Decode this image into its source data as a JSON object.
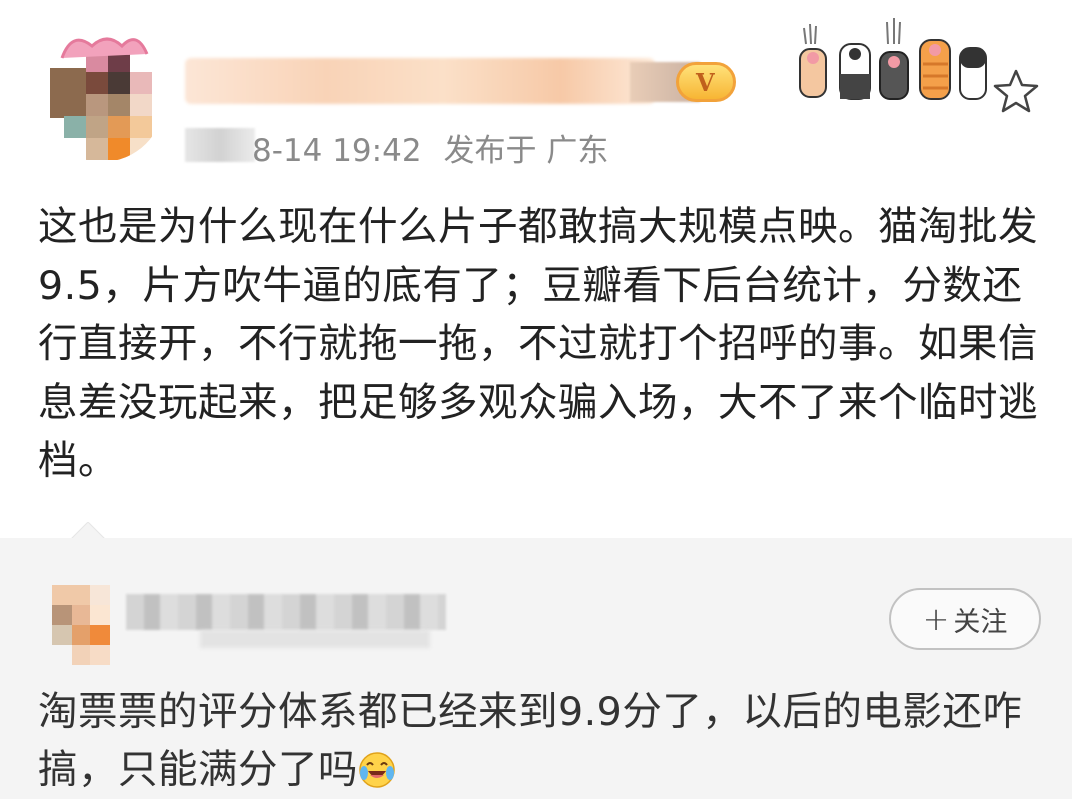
{
  "post": {
    "meta": {
      "date_time": "8-14 19:42",
      "location": "发布于 广东"
    },
    "content": "这也是为什么现在什么片子都敢搞大规模点映。猫淘批发9.5，片方吹牛逼的底有了；豆瓣看下后台统计，分数还行直接开，不行就拖一拖，不过就打个招呼的事。如果信息差没玩起来，把足够多观众骗入场，大不了来个临时逃档。",
    "badge_label": "V",
    "decor_icons": [
      "cat-paw-icon",
      "cat-paw-icon",
      "cat-paw-icon",
      "cat-paw-icon",
      "cat-paw-icon"
    ]
  },
  "reply": {
    "follow_label": "关注",
    "follow_plus": "+",
    "text": "淘票票的评分体系都已经来到9.9分了，以后的电影还咋搞，只能满分了吗",
    "emoji_icon": "laughing-crying-face-icon"
  },
  "colors": {
    "meta_gray": "#8a8a8a",
    "reply_bg": "#f4f4f4",
    "badge_gold": "#f7b534"
  }
}
